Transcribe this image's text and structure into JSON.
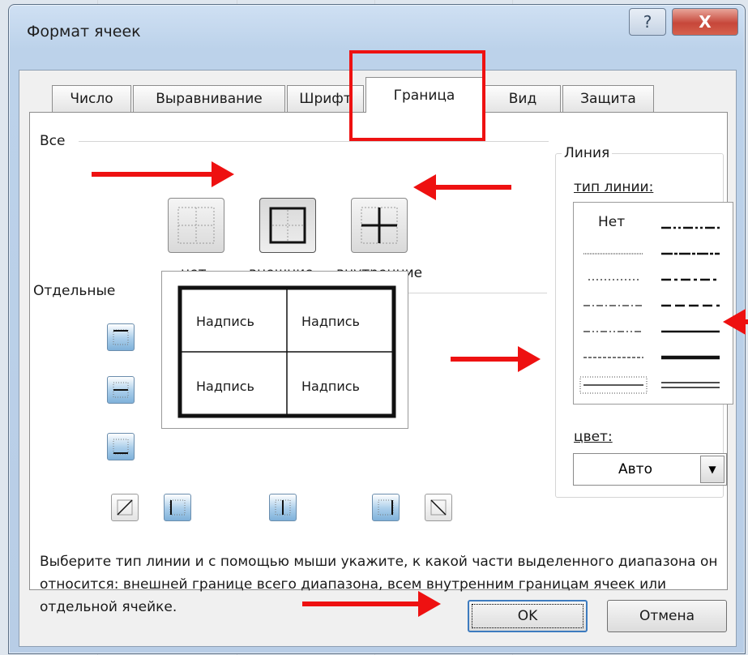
{
  "dialog": {
    "title": "Формат ячеек",
    "help_label": "?",
    "close_label": "X"
  },
  "tabs": [
    {
      "label": "Число",
      "active": false
    },
    {
      "label": "Выравнивание",
      "active": false
    },
    {
      "label": "Шрифт",
      "active": false
    },
    {
      "label": "Граница",
      "active": true
    },
    {
      "label": "Вид",
      "active": false
    },
    {
      "label": "Защита",
      "active": false
    }
  ],
  "presets": {
    "group_label": "Все",
    "items": [
      {
        "label": "нет",
        "icon": "border-none-icon"
      },
      {
        "label": "внешние",
        "icon": "border-outline-icon"
      },
      {
        "label": "внутренние",
        "icon": "border-inside-icon"
      }
    ]
  },
  "individual": {
    "group_label": "Отдельные"
  },
  "preview": {
    "cells": [
      "Надпись",
      "Надпись",
      "Надпись",
      "Надпись"
    ]
  },
  "line": {
    "group_label": "Линия",
    "style_label": "тип линии:",
    "none_label": "Нет",
    "color_label": "цвет:",
    "color_value": "Авто"
  },
  "description": "Выберите тип линии и с помощью мыши укажите, к какой части выделенного диапазона он относится: внешней границе всего диапазона, всем внутренним границам ячеек или отдельной ячейке.",
  "buttons": {
    "ok": "OK",
    "cancel": "Отмена"
  },
  "colors": {
    "annotation": "#ee1111",
    "title_bar": "#bcd2ea",
    "close_button": "#c7473a"
  }
}
